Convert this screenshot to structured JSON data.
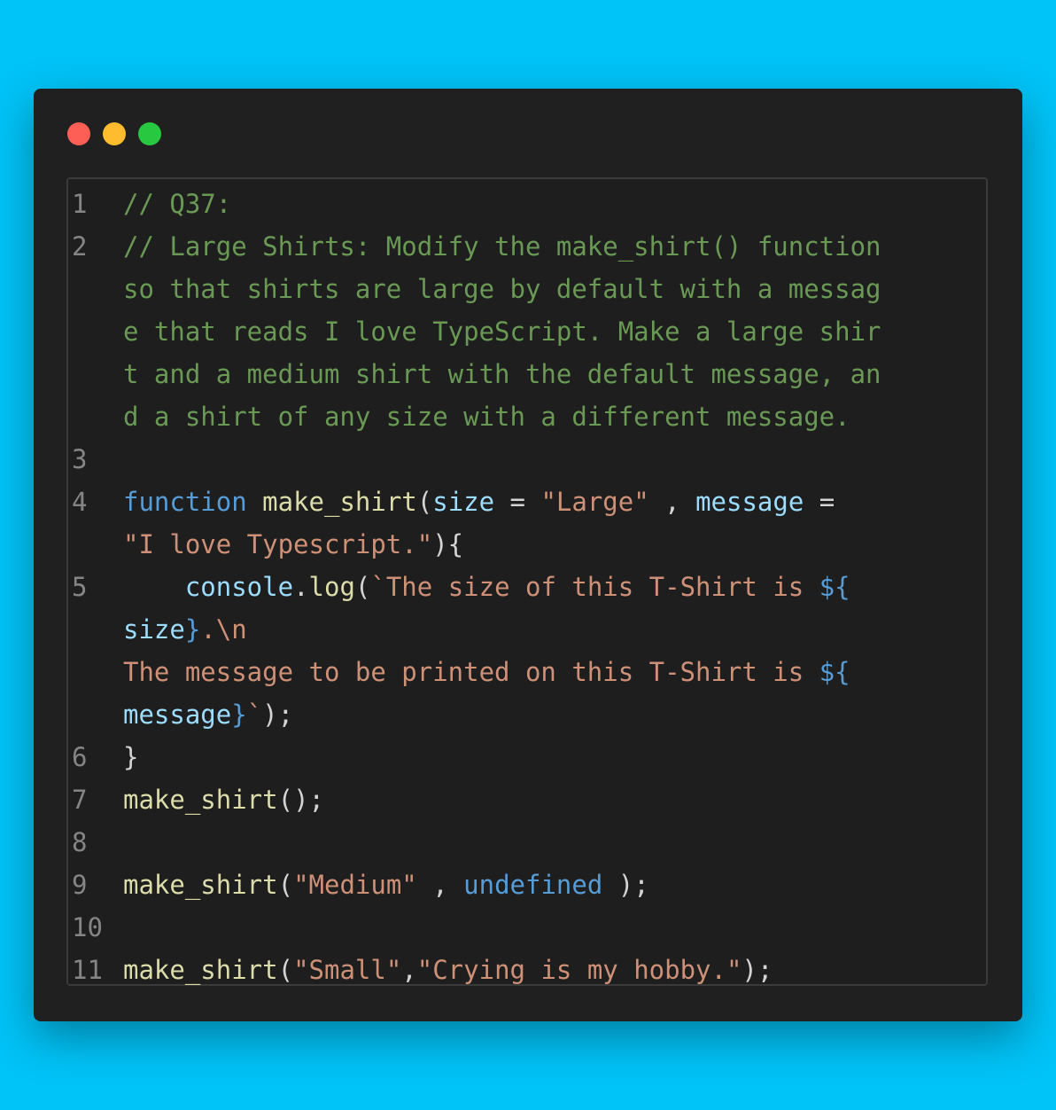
{
  "colors": {
    "background": "#00c3f7",
    "window": "#202020",
    "comment": "#6a9955",
    "keyword": "#569cd6",
    "function": "#dcdcaa",
    "parameter": "#9cdcfe",
    "string": "#ce9178"
  },
  "window_controls": [
    "close-dot",
    "minimize-dot",
    "maximize-dot"
  ],
  "code": {
    "lines": [
      {
        "n": "1",
        "segments": [
          {
            "t": "// Q37:",
            "c": "comment"
          }
        ]
      },
      {
        "n": "2",
        "segments": [
          {
            "t": "// Large Shirts: Modify the make_shirt() function",
            "c": "comment"
          }
        ]
      },
      {
        "n": "",
        "segments": [
          {
            "t": "so that shirts are large by default with a messag",
            "c": "comment"
          }
        ]
      },
      {
        "n": "",
        "segments": [
          {
            "t": "e that reads I love TypeScript. Make a large shir",
            "c": "comment"
          }
        ]
      },
      {
        "n": "",
        "segments": [
          {
            "t": "t and a medium shirt with the default message, an",
            "c": "comment"
          }
        ]
      },
      {
        "n": "",
        "segments": [
          {
            "t": "d a shirt of any size with a different message.",
            "c": "comment"
          }
        ]
      },
      {
        "n": "3",
        "segments": []
      },
      {
        "n": "4",
        "segments": [
          {
            "t": "function",
            "c": "keyword"
          },
          {
            "t": " ",
            "c": "punc"
          },
          {
            "t": "make_shirt",
            "c": "fn"
          },
          {
            "t": "(",
            "c": "punc"
          },
          {
            "t": "size",
            "c": "param"
          },
          {
            "t": " = ",
            "c": "punc"
          },
          {
            "t": "\"Large\"",
            "c": "str"
          },
          {
            "t": " , ",
            "c": "punc"
          },
          {
            "t": "message",
            "c": "param"
          },
          {
            "t": " =",
            "c": "punc"
          }
        ]
      },
      {
        "n": "",
        "segments": [
          {
            "t": "\"I love Typescript.\"",
            "c": "str"
          },
          {
            "t": "){",
            "c": "punc"
          }
        ]
      },
      {
        "n": "5",
        "segments": [
          {
            "t": "    ",
            "c": "punc"
          },
          {
            "t": "console",
            "c": "param"
          },
          {
            "t": ".",
            "c": "punc"
          },
          {
            "t": "log",
            "c": "fn"
          },
          {
            "t": "(",
            "c": "punc"
          },
          {
            "t": "`The size of this T-Shirt is ",
            "c": "str"
          },
          {
            "t": "${",
            "c": "interp"
          }
        ]
      },
      {
        "n": "",
        "segments": [
          {
            "t": "size",
            "c": "param"
          },
          {
            "t": "}",
            "c": "interp"
          },
          {
            "t": ".\\n",
            "c": "str"
          }
        ]
      },
      {
        "n": "",
        "segments": [
          {
            "t": "The message to be printed on this T-Shirt is ",
            "c": "str"
          },
          {
            "t": "${",
            "c": "interp"
          }
        ]
      },
      {
        "n": "",
        "segments": [
          {
            "t": "message",
            "c": "param"
          },
          {
            "t": "}",
            "c": "interp"
          },
          {
            "t": "`",
            "c": "str"
          },
          {
            "t": ");",
            "c": "punc"
          }
        ]
      },
      {
        "n": "6",
        "segments": [
          {
            "t": "}",
            "c": "punc"
          }
        ]
      },
      {
        "n": "7",
        "segments": [
          {
            "t": "make_shirt",
            "c": "fn"
          },
          {
            "t": "();",
            "c": "punc"
          }
        ]
      },
      {
        "n": "8",
        "segments": []
      },
      {
        "n": "9",
        "segments": [
          {
            "t": "make_shirt",
            "c": "fn"
          },
          {
            "t": "(",
            "c": "punc"
          },
          {
            "t": "\"Medium\"",
            "c": "str"
          },
          {
            "t": " , ",
            "c": "punc"
          },
          {
            "t": "undefined",
            "c": "keyword"
          },
          {
            "t": " );",
            "c": "punc"
          }
        ]
      },
      {
        "n": "10",
        "segments": []
      },
      {
        "n": "11",
        "segments": [
          {
            "t": "make_shirt",
            "c": "fn"
          },
          {
            "t": "(",
            "c": "punc"
          },
          {
            "t": "\"Small\"",
            "c": "str"
          },
          {
            "t": ",",
            "c": "punc"
          },
          {
            "t": "\"Crying is my hobby.\"",
            "c": "str"
          },
          {
            "t": ");",
            "c": "punc"
          }
        ]
      }
    ]
  }
}
